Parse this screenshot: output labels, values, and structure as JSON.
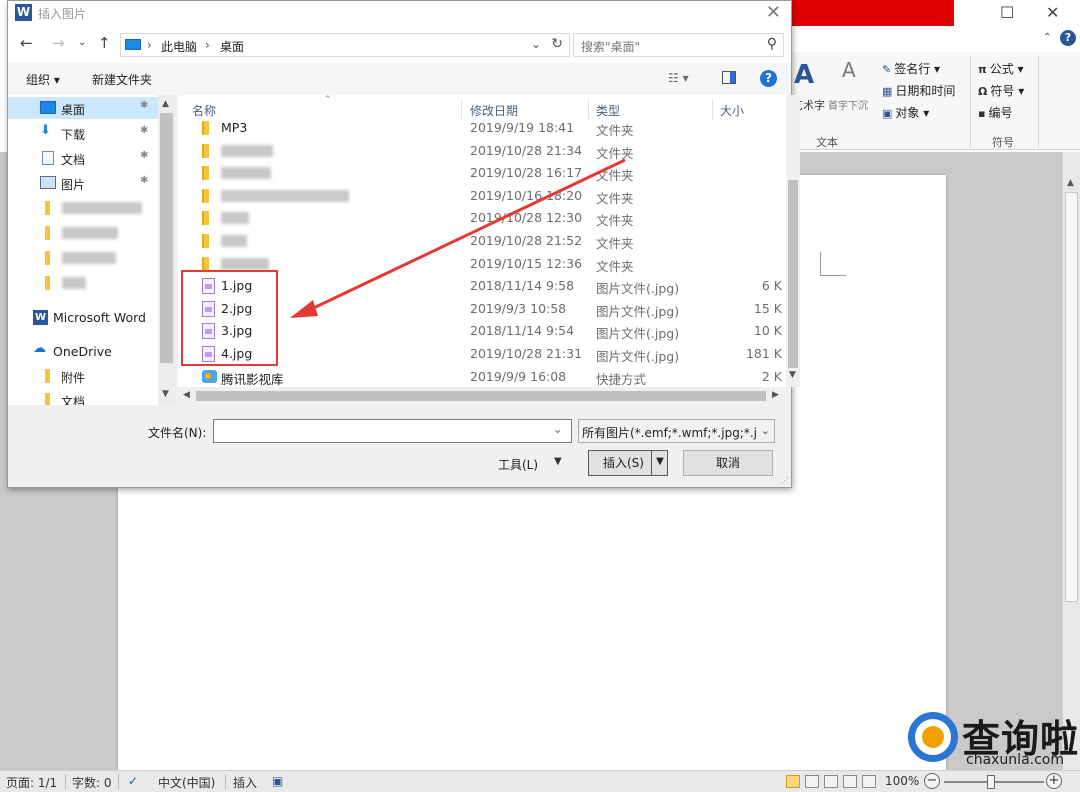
{
  "word": {
    "ribbon": {
      "signature_line": "签名行",
      "datetime": "日期和时间",
      "object": "对象",
      "equation": "公式",
      "symbol": "符号",
      "numbering": "编号",
      "wordart": "艺术字",
      "dropcap": "首字下沉",
      "group_text": "文本",
      "group_symbol": "符号"
    },
    "status": {
      "page": "页面: 1/1",
      "words": "字数: 0",
      "language": "中文(中国)",
      "insert_mode": "插入",
      "zoom": "100%"
    }
  },
  "dialog": {
    "title": "插入图片",
    "app_icon": "W",
    "address": [
      "此电脑",
      "桌面"
    ],
    "search_placeholder": "搜索\"桌面\"",
    "toolbar": {
      "organize": "组织 ▾",
      "new_folder": "新建文件夹"
    },
    "nav_pane": [
      {
        "label": "桌面",
        "icon": "desktop-icon",
        "pinned": true,
        "selected": true
      },
      {
        "label": "下载",
        "icon": "download-icon",
        "pinned": true
      },
      {
        "label": "文档",
        "icon": "document-icon",
        "pinned": true
      },
      {
        "label": "图片",
        "icon": "picture-icon",
        "pinned": true
      },
      {
        "label": "Microsoft Word",
        "icon": "word-icon"
      },
      {
        "label": "OneDrive",
        "icon": "cloud-icon"
      },
      {
        "label": "附件",
        "icon": "folder-icon"
      },
      {
        "label": "文档",
        "icon": "folder-icon"
      }
    ],
    "columns": {
      "name": "名称",
      "date": "修改日期",
      "type": "类型",
      "size": "大小"
    },
    "files": [
      {
        "name": "MP3",
        "date": "2019/9/19 18:41",
        "type": "文件夹",
        "size": "",
        "icon": "folder"
      },
      {
        "name": "",
        "date": "2019/10/28 21:34",
        "type": "文件夹",
        "size": "",
        "icon": "folder",
        "blur": 52
      },
      {
        "name": "",
        "date": "2019/10/28 16:17",
        "type": "文件夹",
        "size": "",
        "icon": "folder",
        "blur": 50
      },
      {
        "name": "",
        "date": "2019/10/16 18:20",
        "type": "文件夹",
        "size": "",
        "icon": "folder",
        "blur": 128
      },
      {
        "name": "",
        "date": "2019/10/28 12:30",
        "type": "文件夹",
        "size": "",
        "icon": "folder",
        "blur": 28
      },
      {
        "name": "",
        "date": "2019/10/28 21:52",
        "type": "文件夹",
        "size": "",
        "icon": "folder",
        "blur": 26
      },
      {
        "name": "",
        "date": "2019/10/15 12:36",
        "type": "文件夹",
        "size": "",
        "icon": "folder",
        "blur": 48
      },
      {
        "name": "1.jpg",
        "date": "2018/11/14 9:58",
        "type": "图片文件(.jpg)",
        "size": "6 K",
        "icon": "image"
      },
      {
        "name": "2.jpg",
        "date": "2019/9/3 10:58",
        "type": "图片文件(.jpg)",
        "size": "15 K",
        "icon": "image"
      },
      {
        "name": "3.jpg",
        "date": "2018/11/14 9:54",
        "type": "图片文件(.jpg)",
        "size": "10 K",
        "icon": "image"
      },
      {
        "name": "4.jpg",
        "date": "2019/10/28 21:31",
        "type": "图片文件(.jpg)",
        "size": "181 K",
        "icon": "image"
      },
      {
        "name": "腾讯影视库",
        "date": "2019/9/9 16:08",
        "type": "快捷方式",
        "size": "2 K",
        "icon": "shortcut"
      }
    ],
    "filename_label": "文件名(N):",
    "filename_value": "",
    "filter": "所有图片(*.emf;*.wmf;*.jpg;*.j",
    "tools": "工具(L)",
    "insert": "插入(S)",
    "cancel": "取消"
  },
  "watermark": {
    "brand": "查询啦",
    "url": "chaxunla.com"
  },
  "colors": {
    "highlight": "#e53935",
    "selection": "#cce8ff",
    "word_title": "#e00000"
  }
}
